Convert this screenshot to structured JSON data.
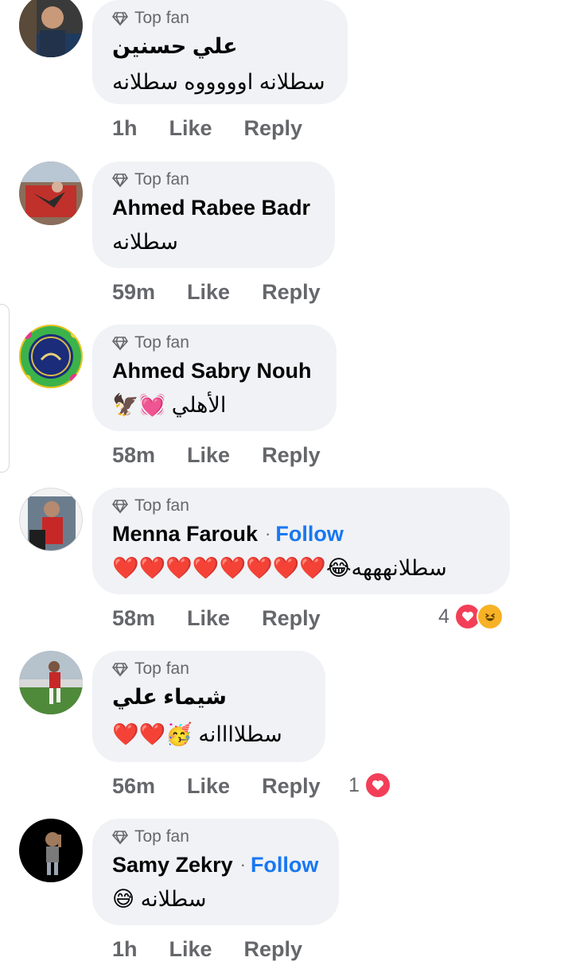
{
  "labels": {
    "top_fan": "Top fan",
    "like": "Like",
    "reply": "Reply",
    "follow": "Follow"
  },
  "comments": [
    {
      "name": "علي حسنين",
      "text": "سطلانه اوووووه سطلانه",
      "time": "1h"
    },
    {
      "name": "Ahmed Rabee Badr",
      "text": "سطلانه",
      "time": "59m"
    },
    {
      "name": "Ahmed Sabry Nouh",
      "text": "الأهلي 💓🦅",
      "time": "58m"
    },
    {
      "name": "Menna Farouk",
      "text": "سطلانهههه😂❤️❤️❤️❤️❤️❤️❤️❤️",
      "time": "58m",
      "reactions": "4"
    },
    {
      "name": "شيماء علي",
      "text": "سطلاااانه 🥳❤️❤️",
      "time": "56m",
      "reactions": "1"
    },
    {
      "name": "Samy Zekry",
      "text": "سطلانه 😅",
      "time": "1h"
    }
  ],
  "colors": {
    "bubble": "#f0f2f5",
    "meta": "#65676b",
    "follow": "#1877f2",
    "love": "#f33e58",
    "haha": "#f7b125"
  }
}
